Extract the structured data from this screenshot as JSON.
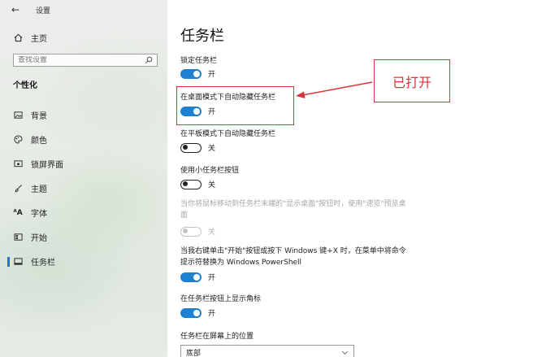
{
  "window": {
    "title": "设置"
  },
  "sidebar": {
    "home_label": "主页",
    "search": {
      "placeholder": "查找设置"
    },
    "section_label": "个性化",
    "items": [
      {
        "label": "背景",
        "icon": "image-icon"
      },
      {
        "label": "颜色",
        "icon": "palette-icon"
      },
      {
        "label": "锁屏界面",
        "icon": "lock-screen-icon"
      },
      {
        "label": "主题",
        "icon": "brush-icon"
      },
      {
        "label": "字体",
        "icon": "font-icon"
      },
      {
        "label": "开始",
        "icon": "start-icon"
      },
      {
        "label": "任务栏",
        "icon": "taskbar-icon",
        "selected": true
      }
    ]
  },
  "main": {
    "title": "任务栏",
    "settings": [
      {
        "label": "锁定任务栏",
        "state": "on",
        "state_label": "开"
      },
      {
        "label": "在桌面模式下自动隐藏任务栏",
        "state": "on",
        "state_label": "开"
      },
      {
        "label": "在平板模式下自动隐藏任务栏",
        "state": "off",
        "state_label": "关"
      },
      {
        "label": "使用小任务栏按钮",
        "state": "off",
        "state_label": "关"
      },
      {
        "label": "当你将鼠标移动到任务栏末端的\"显示桌面\"按钮时，使用\"速览\"预览桌面",
        "state": "off",
        "state_label": "关",
        "disabled": true
      },
      {
        "label": "当我右键单击\"开始\"按钮或按下 Windows 键+X 时，在菜单中将命令提示符替换为 Windows PowerShell",
        "state": "on",
        "state_label": "开"
      },
      {
        "label": "在任务栏按钮上显示角标",
        "state": "on",
        "state_label": "开"
      }
    ],
    "position_label": "任务栏在屏幕上的位置",
    "position_value": "底部"
  },
  "annotation": {
    "callout": "已打开",
    "color": "#d9343a"
  },
  "colors": {
    "accent": "#1f7fd1",
    "active_indicator": "#2d6fd6"
  }
}
